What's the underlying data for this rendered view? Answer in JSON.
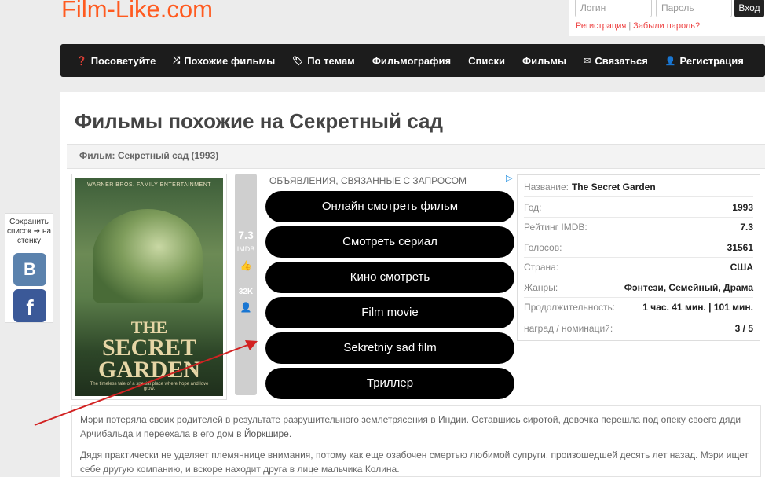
{
  "site": {
    "logo": "Film-Like.com"
  },
  "auth": {
    "login_placeholder": "Логин",
    "password_placeholder": "Пароль",
    "enter_label": "Вход",
    "register_link": "Регистрация",
    "separator": "|",
    "forgot_link": "Забыли пароль?"
  },
  "nav": {
    "items": [
      {
        "icon": "question-circle-icon",
        "glyph": "❓",
        "label": "Посоветуйте"
      },
      {
        "icon": "shuffle-icon",
        "glyph": "⤮",
        "label": "Похожие фильмы"
      },
      {
        "icon": "tag-icon",
        "glyph": "🏷",
        "label": "По темам"
      },
      {
        "icon": "",
        "glyph": "",
        "label": "Фильмография"
      },
      {
        "icon": "",
        "glyph": "",
        "label": "Списки"
      },
      {
        "icon": "",
        "glyph": "",
        "label": "Фильмы"
      },
      {
        "icon": "envelope-icon",
        "glyph": "✉",
        "label": "Связаться"
      },
      {
        "icon": "user-icon",
        "glyph": "👤",
        "label": "Регистрация"
      }
    ]
  },
  "page": {
    "title": "Фильмы похожие на Секретный сад",
    "film_label": "Фильм: Секретный сад (1993)"
  },
  "poster": {
    "studio": "WARNER BROS.   FAMILY ENTERTAINMENT",
    "title_line1": "THE",
    "title_line2": "SECRET",
    "title_line3": "GARDEN",
    "tagline": "The timeless tale of a special place where hope and love grow."
  },
  "rating": {
    "imdb_value": "7.3",
    "imdb_label": "IMDB",
    "votes": "32K"
  },
  "ads": {
    "header": "ОБЪЯВЛЕНИЯ, СВЯЗАННЫЕ С ЗАПРОСОМ",
    "badge": "▷",
    "buttons": [
      "Онлайн смотреть фильм",
      "Смотреть сериал",
      "Кино смотреть",
      "Film movie",
      "Sekretniy sad film",
      "Триллер"
    ]
  },
  "info": {
    "rows": [
      {
        "label": "Название:",
        "value": "The Secret Garden"
      },
      {
        "label": "Год:",
        "value": "1993"
      },
      {
        "label": "Рейтинг IMDB:",
        "value": "7.3"
      },
      {
        "label": "Голосов:",
        "value": "31561"
      },
      {
        "label": "Страна:",
        "value": "США"
      },
      {
        "label": "Жанры:",
        "value": "Фэнтези, Семейный, Драма"
      },
      {
        "label": "Продолжительность:",
        "value": "1 час. 41 мин. | 101 мин."
      },
      {
        "label": "наград / номинаций:",
        "value": "3 / 5"
      }
    ]
  },
  "description": {
    "p1_text": "Мэри потеряла своих родителей в результате разрушительного землетрясения в Индии. Оставшись сиротой, девочка перешла под опеку своего дяди Арчибальда и переехала в его дом в ",
    "p1_link": "Йоркшире",
    "p1_end": ".",
    "p2_text": "Дядя практически не уделяет племяннице внимания, потому как еще озабочен смертью любимой супруги, произошедшей десять лет назад. Мэри ищет себе другую компанию, и вскоре находит друга в лице мальчика Колина."
  },
  "share": {
    "label": "Сохранить список ➔ на стенку",
    "vk": "В",
    "fb": "f"
  },
  "colors": {
    "logo": "#ff5a1f",
    "nav_bg": "#1c1c1c",
    "ad_button": "#000000",
    "vk": "#5b82ad",
    "facebook": "#3b5998",
    "annotation_arrow": "#d22222"
  }
}
